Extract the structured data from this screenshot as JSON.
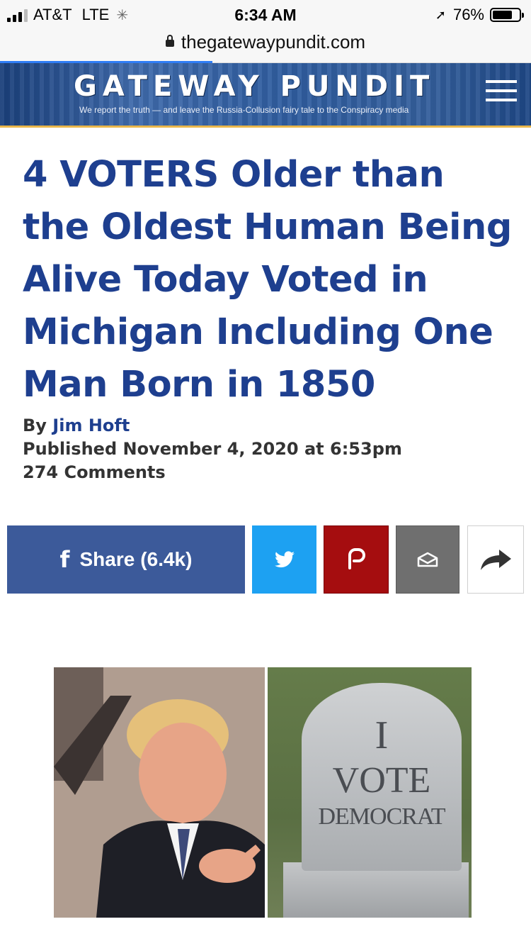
{
  "status_bar": {
    "carrier": "AT&T",
    "network": "LTE",
    "time": "6:34 AM",
    "battery_percent": "76%",
    "battery_level": 0.76
  },
  "browser": {
    "url": "thegatewaypundit.com",
    "load_progress": 0.4
  },
  "site": {
    "title": "GATEWAY PUNDIT",
    "tagline": "We report the truth — and leave the Russia-Collusion fairy tale to the Conspiracy media",
    "menu_icon": "hamburger-menu-icon"
  },
  "article": {
    "headline": "4 VOTERS Older than the Oldest Human Being Alive Today Voted in Michigan Including One Man Born in 1850",
    "byline_prefix": "By",
    "author": "Jim Hoft",
    "published": "Published November 4, 2020 at 6:53pm",
    "comments": "274 Comments"
  },
  "share": {
    "facebook_label": "Share",
    "facebook_count": "(6.4k)",
    "colors": {
      "facebook": "#3c5a9a",
      "twitter": "#1da1f2",
      "parler": "#a50d0f",
      "email": "#6f6f6f"
    }
  },
  "image": {
    "tombstone_line1": "I",
    "tombstone_line2": "VOTE",
    "tombstone_line3": "DEMOCRAT"
  },
  "colors": {
    "headline": "#1e3f8f",
    "header_accent": "#e9b64a"
  }
}
